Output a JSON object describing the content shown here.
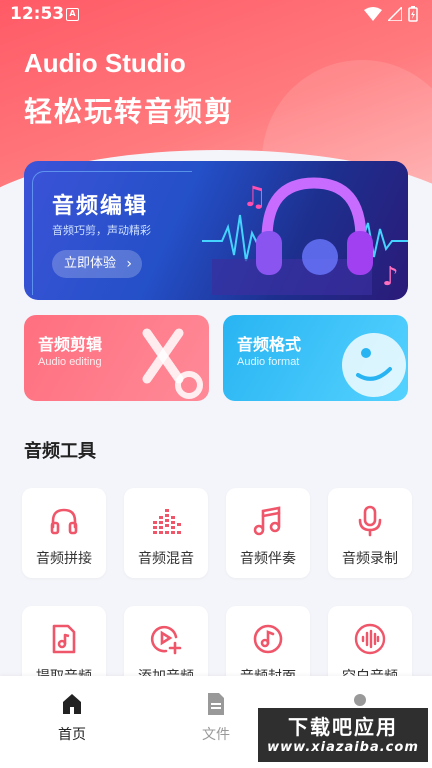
{
  "status_bar": {
    "time": "12:53",
    "notification_letter": "A"
  },
  "header": {
    "title": "Audio Studio",
    "subtitle": "轻松玩转音频剪"
  },
  "banner": {
    "title": "音频编辑",
    "subtitle": "音频巧剪，声动精彩",
    "button_label": "立即体验",
    "button_icon": "chevron-right-icon"
  },
  "cards": [
    {
      "title": "音频剪辑",
      "subtitle": "Audio editing",
      "color": "#ff6f7f",
      "icon": "scissors-icon"
    },
    {
      "title": "音频格式",
      "subtitle": "Audio format",
      "color": "#28b4f2",
      "icon": "disc-icon"
    }
  ],
  "tools_section": {
    "title": "音频工具",
    "items": [
      {
        "label": "音频拼接",
        "icon": "headphones-icon"
      },
      {
        "label": "音频混音",
        "icon": "equalizer-icon"
      },
      {
        "label": "音频伴奏",
        "icon": "music-note-icon"
      },
      {
        "label": "音频录制",
        "icon": "microphone-icon"
      },
      {
        "label": "提取音频",
        "icon": "file-music-icon"
      },
      {
        "label": "添加音频",
        "icon": "add-audio-icon"
      },
      {
        "label": "音频封面",
        "icon": "music-circle-icon"
      },
      {
        "label": "空白音频",
        "icon": "soundwave-icon"
      }
    ],
    "accent_color": "#f0566a"
  },
  "bottom_nav": {
    "items": [
      {
        "label": "首页",
        "icon": "home-icon",
        "active": true
      },
      {
        "label": "文件",
        "icon": "file-icon",
        "active": false
      },
      {
        "label": "",
        "icon": "user-icon",
        "active": false
      }
    ]
  },
  "watermark": {
    "line1": "下载吧应用",
    "line2": "www.xiazaiba.com"
  }
}
